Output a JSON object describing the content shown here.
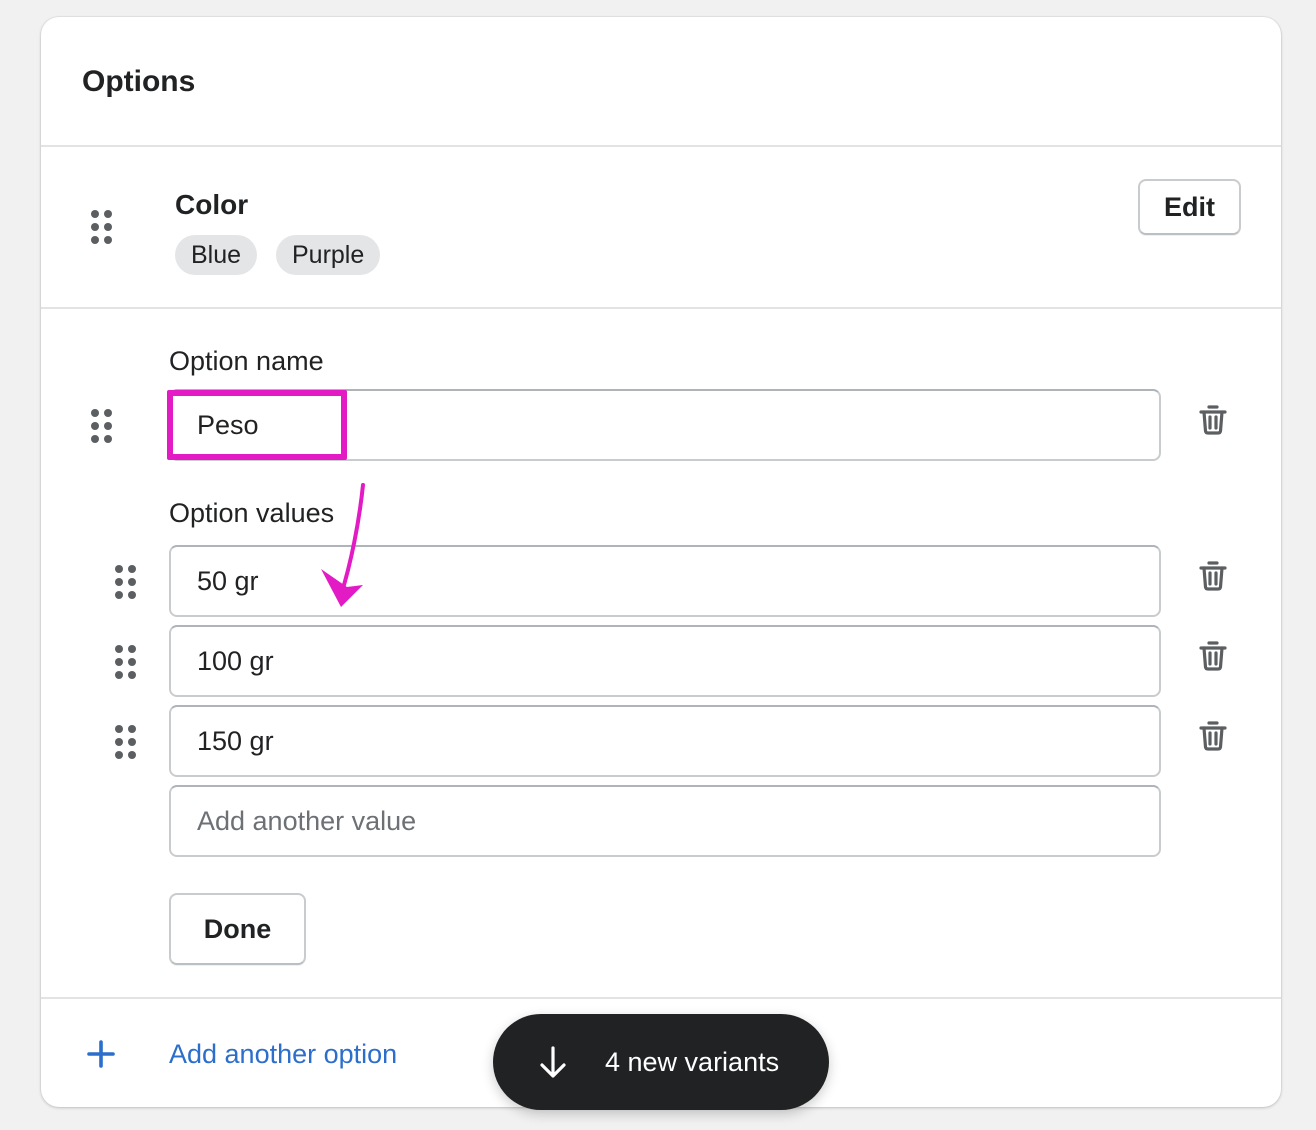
{
  "card": {
    "title": "Options"
  },
  "saved_option": {
    "name": "Color",
    "values": [
      "Blue",
      "Purple"
    ],
    "edit_label": "Edit"
  },
  "editing_option": {
    "name_label": "Option name",
    "name_value": "Peso",
    "values_label": "Option values",
    "values": [
      "50 gr",
      "100 gr",
      "150 gr"
    ],
    "new_value_placeholder": "Add another value",
    "done_label": "Done"
  },
  "footer": {
    "add_option_label": "Add another option"
  },
  "toast": {
    "label": "4 new variants"
  },
  "colors": {
    "annotation": "#e21bc4",
    "link": "#2c6ecb",
    "toast_bg": "#202223"
  },
  "icons": {
    "drag": "drag-handle-icon",
    "trash": "trash-icon",
    "plus": "plus-icon",
    "arrow_down": "arrow-down-icon"
  }
}
